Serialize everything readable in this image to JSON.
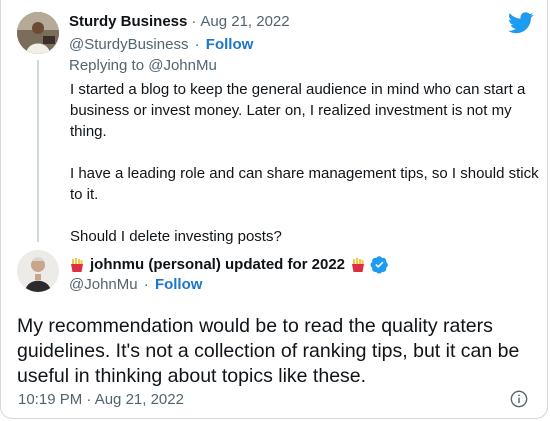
{
  "reply_tweet": {
    "author_name": "Sturdy Business",
    "separator": "·",
    "date": "Aug 21, 2022",
    "handle": "@SturdyBusiness",
    "follow_label": "Follow",
    "replying_prefix": "Replying to",
    "replying_to": "@JohnMu",
    "paragraphs": [
      "I started a blog to keep the general audience in mind who can start a business or invest money. Later on, I realized investment is not my thing.",
      "I have a leading role and can share management tips, so I should stick to it.",
      "Should I delete investing posts?"
    ]
  },
  "main_tweet": {
    "author_name": "johnmu (personal) updated for 2022",
    "handle": "@JohnMu",
    "separator": "·",
    "follow_label": "Follow",
    "text": "My recommendation would be to read the quality raters guidelines. It's not a collection of ranking tips, but it can be useful in thinking about topics like these.",
    "timestamp": "10:19 PM · Aug 21, 2022",
    "verified": true
  },
  "colors": {
    "link": "#1d77c8",
    "muted": "#536471",
    "twitter_blue": "#1d9bf0",
    "border": "#cfd9de"
  },
  "icons": {
    "brand": "twitter-bird-icon",
    "info": "info-icon",
    "verified": "verified-badge-icon",
    "emoji": "fries-emoji-icon"
  }
}
